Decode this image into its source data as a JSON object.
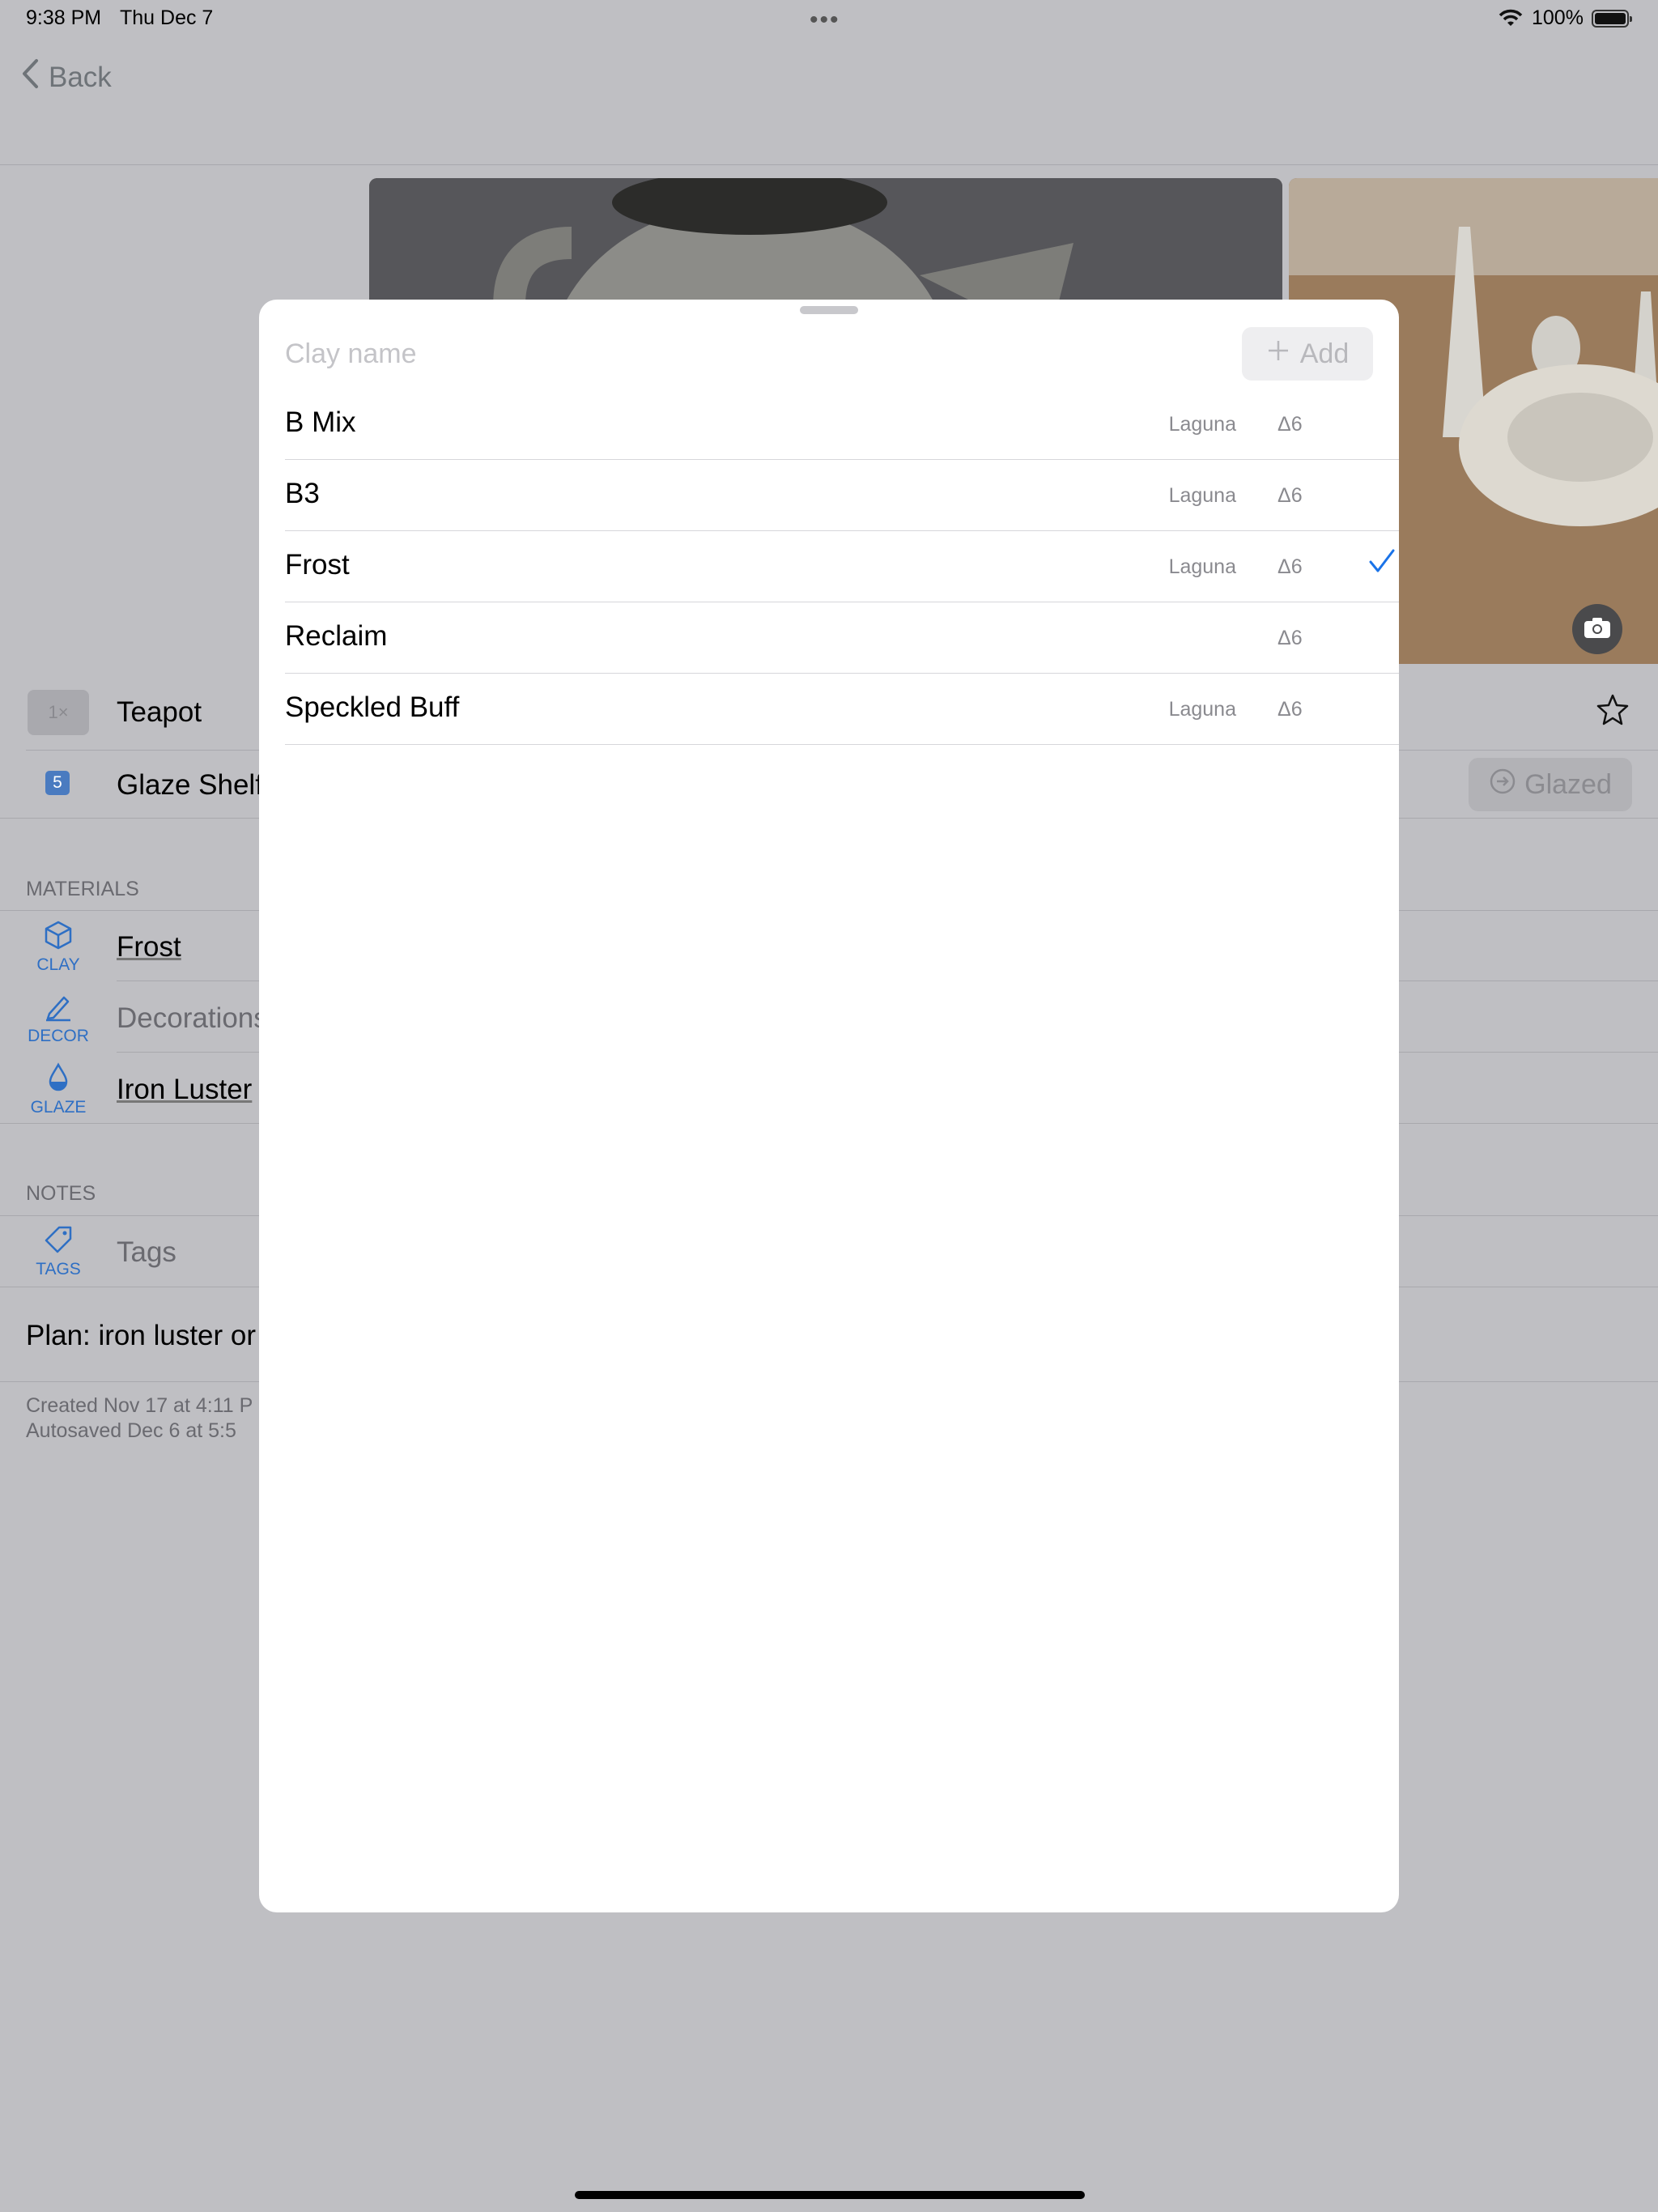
{
  "status_bar": {
    "time": "9:38 PM",
    "date": "Thu Dec 7",
    "multitask_dots": "•••",
    "battery_percent": "100%"
  },
  "nav": {
    "back_label": "Back"
  },
  "piece": {
    "quantity_badge": "1×",
    "title": "Teapot",
    "location_badge": "5",
    "location": "Glaze Shelf",
    "status_button": "Glazed"
  },
  "materials": {
    "section_label": "MATERIALS",
    "rows": [
      {
        "icon_label": "CLAY",
        "value": "Frost"
      },
      {
        "icon_label": "DECOR",
        "value": "Decorations"
      },
      {
        "icon_label": "GLAZE",
        "value": "Iron Luster"
      }
    ]
  },
  "notes": {
    "section_label": "NOTES",
    "tags_icon_label": "TAGS",
    "tags_placeholder": "Tags",
    "plan_text": "Plan: iron luster or S"
  },
  "footer": {
    "created": "Created Nov 17 at 4:11 P",
    "autosaved": "Autosaved Dec 6 at 5:5"
  },
  "picker": {
    "search_placeholder": "Clay name",
    "add_label": "Add",
    "items": [
      {
        "name": "B Mix",
        "brand": "Laguna",
        "cone": "Δ6",
        "selected": false
      },
      {
        "name": "B3",
        "brand": "Laguna",
        "cone": "Δ6",
        "selected": false
      },
      {
        "name": "Frost",
        "brand": "Laguna",
        "cone": "Δ6",
        "selected": true
      },
      {
        "name": "Reclaim",
        "brand": "",
        "cone": "Δ6",
        "selected": false
      },
      {
        "name": "Speckled Buff",
        "brand": "Laguna",
        "cone": "Δ6",
        "selected": false
      }
    ]
  },
  "colors": {
    "accent": "#2e6fc4",
    "checkmark": "#1a73e8",
    "dimmed_background": "#bfbfc3",
    "sheet": "#ffffff"
  },
  "icons": {
    "back": "chevron-left-icon",
    "camera": "camera-icon",
    "star": "star-icon",
    "clay": "cube-icon",
    "decor": "pencil-icon",
    "glaze": "drop-icon",
    "tags": "tag-icon",
    "add": "plus-icon",
    "selected": "checkmark-icon",
    "glazed": "arrow-circle-icon",
    "wifi": "wifi-icon",
    "battery": "battery-icon"
  }
}
